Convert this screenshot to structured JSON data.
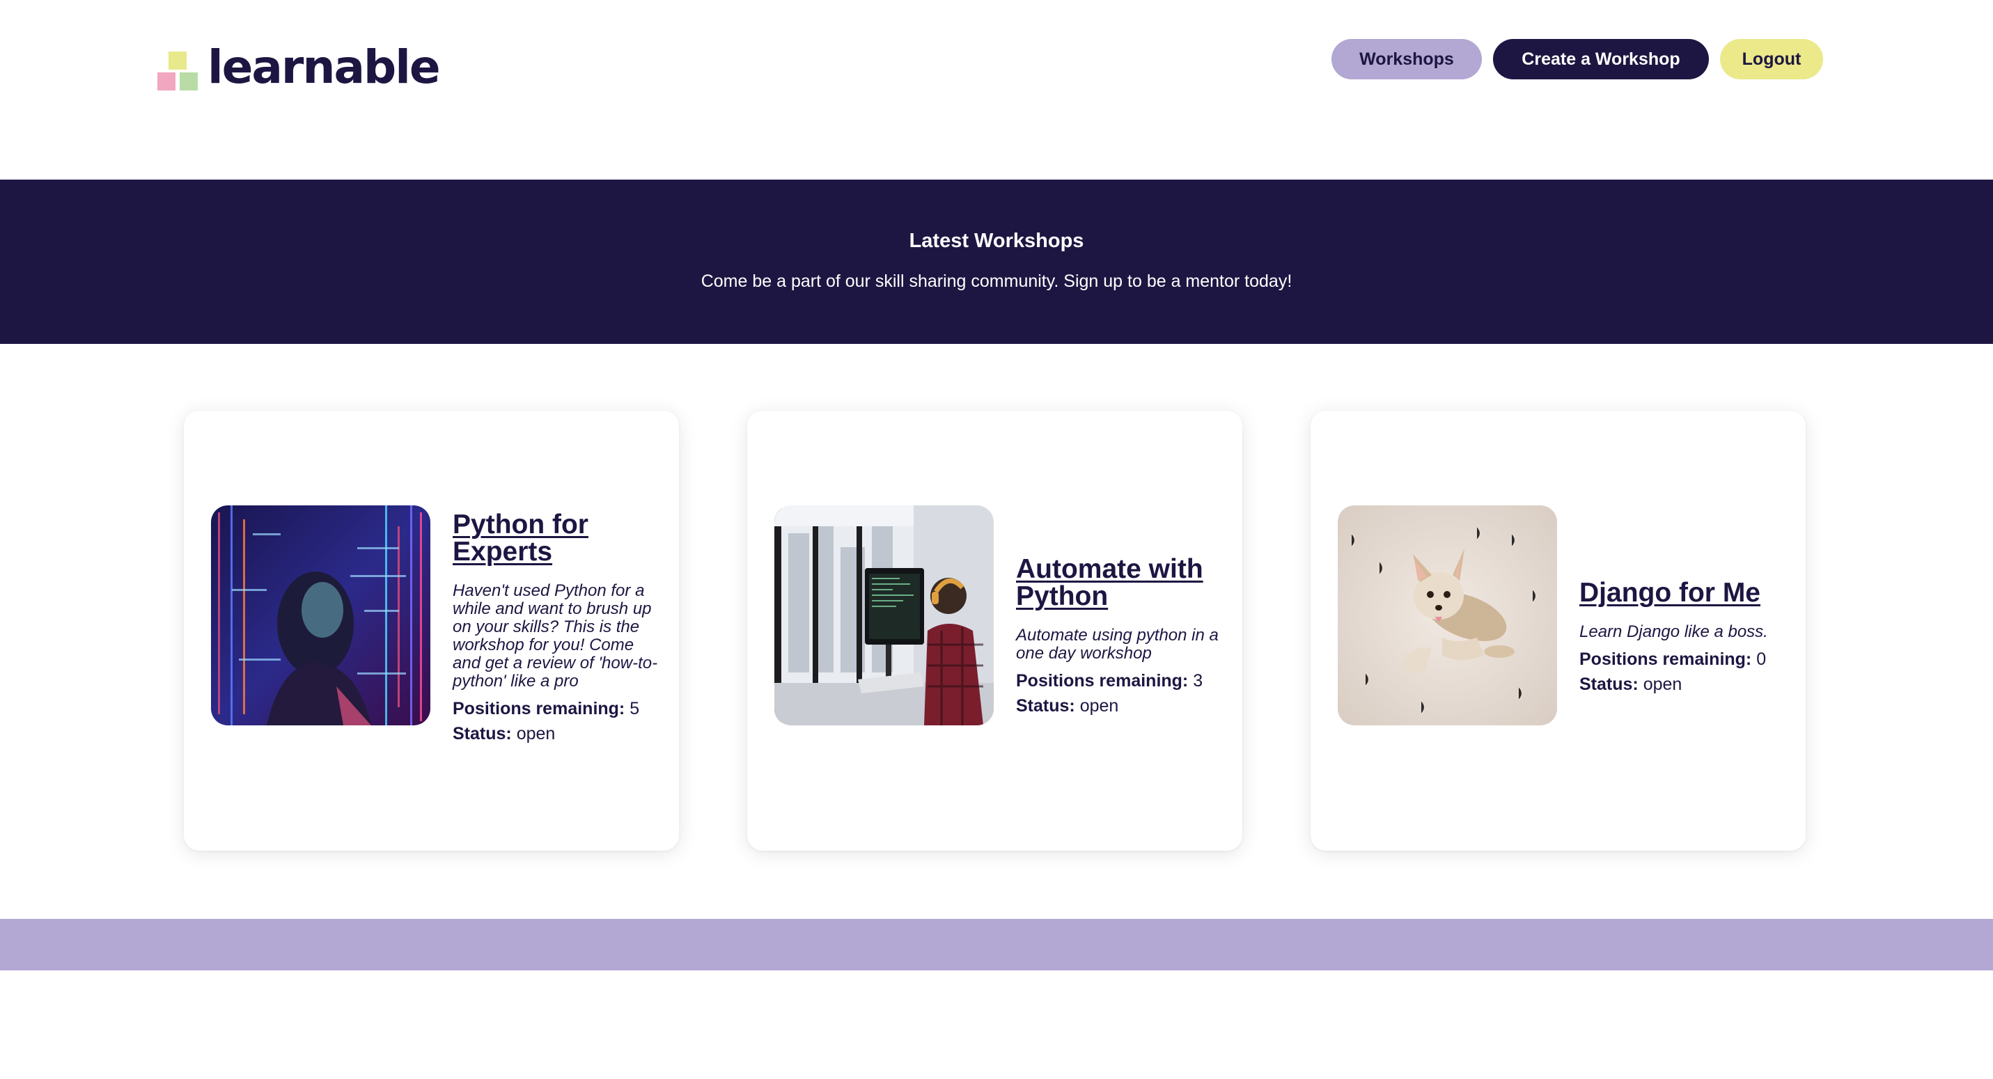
{
  "brand": {
    "name": "learnable",
    "colors": {
      "navy": "#1d1642",
      "lavender": "#b2a8d3",
      "yellow": "#ebe98a",
      "pink": "#f2a7c0",
      "green": "#b9dca6"
    }
  },
  "nav": {
    "workshops_label": "Workshops",
    "create_label": "Create a Workshop",
    "logout_label": "Logout"
  },
  "hero": {
    "title": "Latest Workshops",
    "subtitle": "Come be a part of our skill sharing community. Sign up to be a mentor today!"
  },
  "workshops": [
    {
      "title": "Python for Experts",
      "description": "Haven't used Python for a while and want to brush up on your skills? This is the workshop for you! Come and get a review of 'how-to-python' like a pro",
      "positions_label": "Positions remaining:",
      "positions_value": "5",
      "status_label": "Status:",
      "status_value": "open",
      "image": "person-with-code-projection-photo"
    },
    {
      "title": "Automate with Python",
      "description": "Automate using python in a one day workshop",
      "positions_label": "Positions remaining:",
      "positions_value": "3",
      "status_label": "Status:",
      "status_value": "open",
      "image": "developer-at-standing-desk-photo"
    },
    {
      "title": "Django for Me",
      "description": "Learn Django like a boss.",
      "positions_label": "Positions remaining:",
      "positions_value": "0",
      "status_label": "Status:",
      "status_value": "open",
      "image": "chihuahua-on-rug-photo"
    }
  ]
}
